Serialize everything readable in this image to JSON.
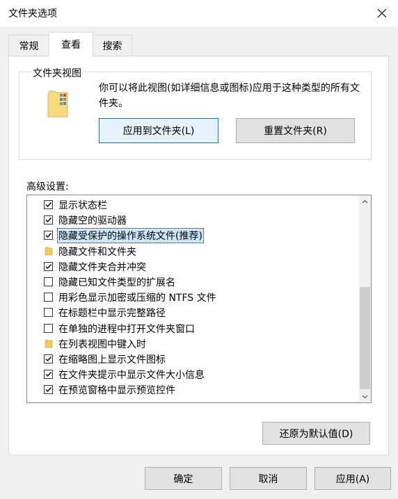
{
  "window": {
    "title": "文件夹选项"
  },
  "tabs": [
    {
      "label": "常规"
    },
    {
      "label": "查看"
    },
    {
      "label": "搜索"
    }
  ],
  "folder_views": {
    "title": "文件夹视图",
    "description": "你可以将此视图(如详细信息或图标)应用于这种类型的所有文件夹。",
    "apply_button": "应用到文件夹(L)",
    "reset_button": "重置文件夹(R)"
  },
  "advanced": {
    "label": "高级设置:",
    "items": [
      {
        "type": "checkbox",
        "checked": true,
        "label": "显示状态栏"
      },
      {
        "type": "checkbox",
        "checked": true,
        "label": "隐藏空的驱动器"
      },
      {
        "type": "checkbox",
        "checked": true,
        "label": "隐藏受保护的操作系统文件(推荐)",
        "selected": true
      },
      {
        "type": "folder",
        "label": "隐藏文件和文件夹"
      },
      {
        "type": "checkbox",
        "checked": true,
        "label": "隐藏文件夹合并冲突"
      },
      {
        "type": "checkbox",
        "checked": false,
        "label": "隐藏已知文件类型的扩展名"
      },
      {
        "type": "checkbox",
        "checked": false,
        "label": "用彩色显示加密或压缩的 NTFS 文件"
      },
      {
        "type": "checkbox",
        "checked": false,
        "label": "在标题栏中显示完整路径"
      },
      {
        "type": "checkbox",
        "checked": false,
        "label": "在单独的进程中打开文件夹窗口"
      },
      {
        "type": "folder",
        "label": "在列表视图中键入时"
      },
      {
        "type": "checkbox",
        "checked": true,
        "label": "在缩略图上显示文件图标"
      },
      {
        "type": "checkbox",
        "checked": true,
        "label": "在文件夹提示中显示文件大小信息"
      },
      {
        "type": "checkbox",
        "checked": true,
        "label": "在预览窗格中显示预览控件"
      }
    ],
    "restore_button": "还原为默认值(D)"
  },
  "footer": {
    "ok": "确定",
    "cancel": "取消",
    "apply": "应用(A)"
  },
  "colors": {
    "accent": "#0078d7",
    "selection": "#cce8ff"
  }
}
